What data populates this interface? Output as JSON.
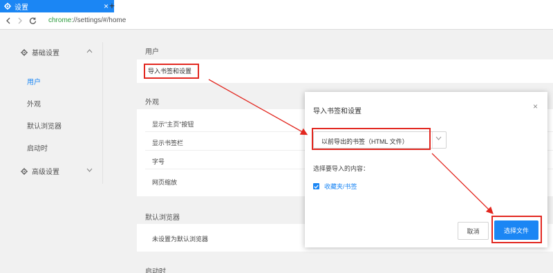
{
  "tab": {
    "title": "设置",
    "icon": "gear-icon",
    "close": "×",
    "new_tab": "+"
  },
  "address_bar": {
    "scheme": "chrome:",
    "rest": "//settings/#/home"
  },
  "sidebar": {
    "basic_group": {
      "label": "基础设置",
      "icon": "gear-icon"
    },
    "items": [
      {
        "label": "用户",
        "active": true
      },
      {
        "label": "外观",
        "active": false
      },
      {
        "label": "默认浏览器",
        "active": false
      },
      {
        "label": "启动时",
        "active": false
      }
    ],
    "advanced_group": {
      "label": "高级设置",
      "icon": "gear-icon"
    }
  },
  "main": {
    "users_section": {
      "title": "用户",
      "import_label": "导入书签和设置"
    },
    "appearance_section": {
      "title": "外观",
      "rows": [
        "显示\"主页\"按钮",
        "显示书签栏",
        "字号",
        "网页缩放"
      ]
    },
    "default_browser_section": {
      "title": "默认浏览器",
      "row": "未设置为默认浏览器"
    },
    "startup_section": {
      "title": "启动时"
    }
  },
  "dialog": {
    "title": "导入书签和设置",
    "close": "×",
    "select_value": "以前导出的书签（HTML 文件）",
    "content_label": "选择要导入的内容：",
    "checkbox_label": "收藏夹/书签",
    "checkbox_checked": true,
    "cancel_label": "取消",
    "choose_label": "选择文件"
  },
  "colors": {
    "accent": "#1b86f4",
    "annotation": "#e2271f",
    "url_scheme": "#2a9a3c"
  }
}
